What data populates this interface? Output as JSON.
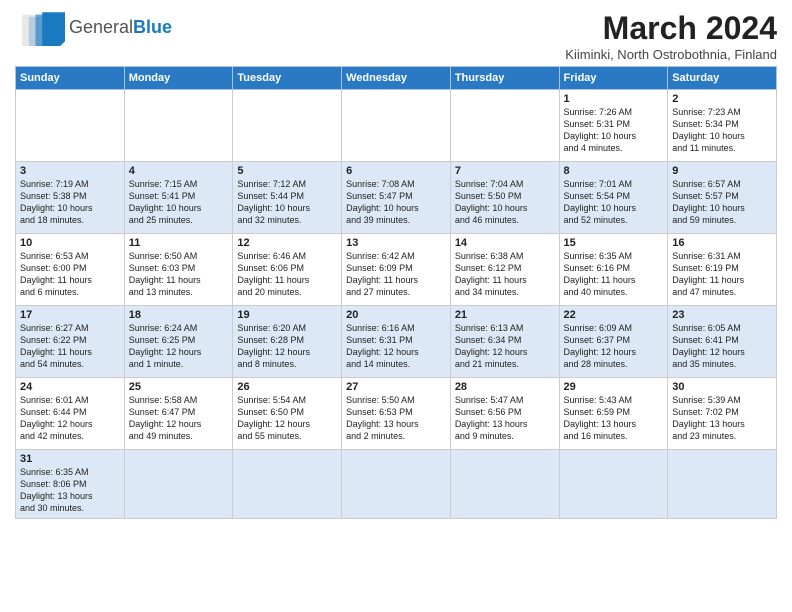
{
  "header": {
    "logo_general": "General",
    "logo_blue": "Blue",
    "title": "March 2024",
    "subtitle": "Kiiminki, North Ostrobothnia, Finland"
  },
  "weekdays": [
    "Sunday",
    "Monday",
    "Tuesday",
    "Wednesday",
    "Thursday",
    "Friday",
    "Saturday"
  ],
  "weeks": [
    [
      {
        "day": "",
        "info": ""
      },
      {
        "day": "",
        "info": ""
      },
      {
        "day": "",
        "info": ""
      },
      {
        "day": "",
        "info": ""
      },
      {
        "day": "",
        "info": ""
      },
      {
        "day": "1",
        "info": "Sunrise: 7:26 AM\nSunset: 5:31 PM\nDaylight: 10 hours\nand 4 minutes."
      },
      {
        "day": "2",
        "info": "Sunrise: 7:23 AM\nSunset: 5:34 PM\nDaylight: 10 hours\nand 11 minutes."
      }
    ],
    [
      {
        "day": "3",
        "info": "Sunrise: 7:19 AM\nSunset: 5:38 PM\nDaylight: 10 hours\nand 18 minutes."
      },
      {
        "day": "4",
        "info": "Sunrise: 7:15 AM\nSunset: 5:41 PM\nDaylight: 10 hours\nand 25 minutes."
      },
      {
        "day": "5",
        "info": "Sunrise: 7:12 AM\nSunset: 5:44 PM\nDaylight: 10 hours\nand 32 minutes."
      },
      {
        "day": "6",
        "info": "Sunrise: 7:08 AM\nSunset: 5:47 PM\nDaylight: 10 hours\nand 39 minutes."
      },
      {
        "day": "7",
        "info": "Sunrise: 7:04 AM\nSunset: 5:50 PM\nDaylight: 10 hours\nand 46 minutes."
      },
      {
        "day": "8",
        "info": "Sunrise: 7:01 AM\nSunset: 5:54 PM\nDaylight: 10 hours\nand 52 minutes."
      },
      {
        "day": "9",
        "info": "Sunrise: 6:57 AM\nSunset: 5:57 PM\nDaylight: 10 hours\nand 59 minutes."
      }
    ],
    [
      {
        "day": "10",
        "info": "Sunrise: 6:53 AM\nSunset: 6:00 PM\nDaylight: 11 hours\nand 6 minutes."
      },
      {
        "day": "11",
        "info": "Sunrise: 6:50 AM\nSunset: 6:03 PM\nDaylight: 11 hours\nand 13 minutes."
      },
      {
        "day": "12",
        "info": "Sunrise: 6:46 AM\nSunset: 6:06 PM\nDaylight: 11 hours\nand 20 minutes."
      },
      {
        "day": "13",
        "info": "Sunrise: 6:42 AM\nSunset: 6:09 PM\nDaylight: 11 hours\nand 27 minutes."
      },
      {
        "day": "14",
        "info": "Sunrise: 6:38 AM\nSunset: 6:12 PM\nDaylight: 11 hours\nand 34 minutes."
      },
      {
        "day": "15",
        "info": "Sunrise: 6:35 AM\nSunset: 6:16 PM\nDaylight: 11 hours\nand 40 minutes."
      },
      {
        "day": "16",
        "info": "Sunrise: 6:31 AM\nSunset: 6:19 PM\nDaylight: 11 hours\nand 47 minutes."
      }
    ],
    [
      {
        "day": "17",
        "info": "Sunrise: 6:27 AM\nSunset: 6:22 PM\nDaylight: 11 hours\nand 54 minutes."
      },
      {
        "day": "18",
        "info": "Sunrise: 6:24 AM\nSunset: 6:25 PM\nDaylight: 12 hours\nand 1 minute."
      },
      {
        "day": "19",
        "info": "Sunrise: 6:20 AM\nSunset: 6:28 PM\nDaylight: 12 hours\nand 8 minutes."
      },
      {
        "day": "20",
        "info": "Sunrise: 6:16 AM\nSunset: 6:31 PM\nDaylight: 12 hours\nand 14 minutes."
      },
      {
        "day": "21",
        "info": "Sunrise: 6:13 AM\nSunset: 6:34 PM\nDaylight: 12 hours\nand 21 minutes."
      },
      {
        "day": "22",
        "info": "Sunrise: 6:09 AM\nSunset: 6:37 PM\nDaylight: 12 hours\nand 28 minutes."
      },
      {
        "day": "23",
        "info": "Sunrise: 6:05 AM\nSunset: 6:41 PM\nDaylight: 12 hours\nand 35 minutes."
      }
    ],
    [
      {
        "day": "24",
        "info": "Sunrise: 6:01 AM\nSunset: 6:44 PM\nDaylight: 12 hours\nand 42 minutes."
      },
      {
        "day": "25",
        "info": "Sunrise: 5:58 AM\nSunset: 6:47 PM\nDaylight: 12 hours\nand 49 minutes."
      },
      {
        "day": "26",
        "info": "Sunrise: 5:54 AM\nSunset: 6:50 PM\nDaylight: 12 hours\nand 55 minutes."
      },
      {
        "day": "27",
        "info": "Sunrise: 5:50 AM\nSunset: 6:53 PM\nDaylight: 13 hours\nand 2 minutes."
      },
      {
        "day": "28",
        "info": "Sunrise: 5:47 AM\nSunset: 6:56 PM\nDaylight: 13 hours\nand 9 minutes."
      },
      {
        "day": "29",
        "info": "Sunrise: 5:43 AM\nSunset: 6:59 PM\nDaylight: 13 hours\nand 16 minutes."
      },
      {
        "day": "30",
        "info": "Sunrise: 5:39 AM\nSunset: 7:02 PM\nDaylight: 13 hours\nand 23 minutes."
      }
    ],
    [
      {
        "day": "31",
        "info": "Sunrise: 6:35 AM\nSunset: 8:06 PM\nDaylight: 13 hours\nand 30 minutes."
      },
      {
        "day": "",
        "info": ""
      },
      {
        "day": "",
        "info": ""
      },
      {
        "day": "",
        "info": ""
      },
      {
        "day": "",
        "info": ""
      },
      {
        "day": "",
        "info": ""
      },
      {
        "day": "",
        "info": ""
      }
    ]
  ],
  "row_styles": [
    "row-white",
    "row-blue",
    "row-white",
    "row-blue",
    "row-white",
    "row-blue"
  ]
}
